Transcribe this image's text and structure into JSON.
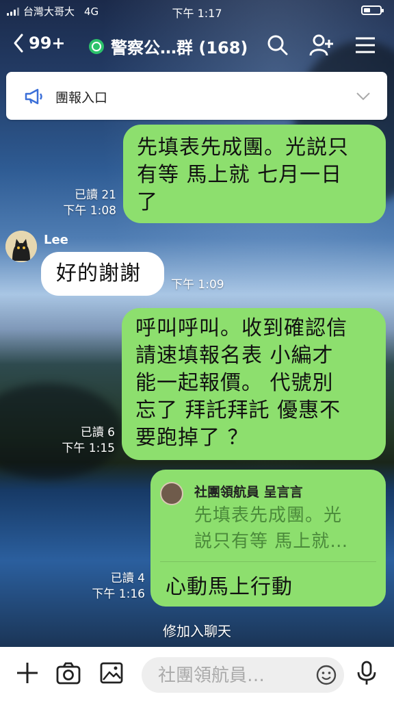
{
  "status_bar": {
    "carrier": "台灣大哥大",
    "network": "4G",
    "time": "下午 1:17"
  },
  "header": {
    "back_count": "99+",
    "title": "警察公…群 (168)"
  },
  "notice": {
    "label": "團報入口"
  },
  "messages": [
    {
      "type": "outgoing",
      "text": "先填表先成團。光説只\n有等 馬上就 七月一日\n了",
      "read": "已讀 21",
      "time": "下午 1:08"
    },
    {
      "type": "incoming",
      "sender": "Lee",
      "text": "好的謝謝",
      "time": "下午 1:09"
    },
    {
      "type": "outgoing",
      "text": "呼叫呼叫。收到確認信\n請速填報名表 小編才\n能一起報價。 代號別\n忘了 拜託拜託 優惠不\n要跑掉了 ？",
      "read": "已讀 6",
      "time": "下午 1:15"
    },
    {
      "type": "reply",
      "quote_name": "社團領航員 呈言言",
      "quote_text": "先填表先成團。光\n説只有等 馬上就…",
      "text": "心動馬上行動",
      "read": "已讀 4",
      "time": "下午 1:16"
    }
  ],
  "system_message": "修加入聊天",
  "input": {
    "placeholder": "社團領航員…"
  },
  "colors": {
    "bubble_outgoing": "#8ddf6e",
    "bubble_incoming": "#ffffff",
    "open_chat_badge": "#2cc36b"
  }
}
